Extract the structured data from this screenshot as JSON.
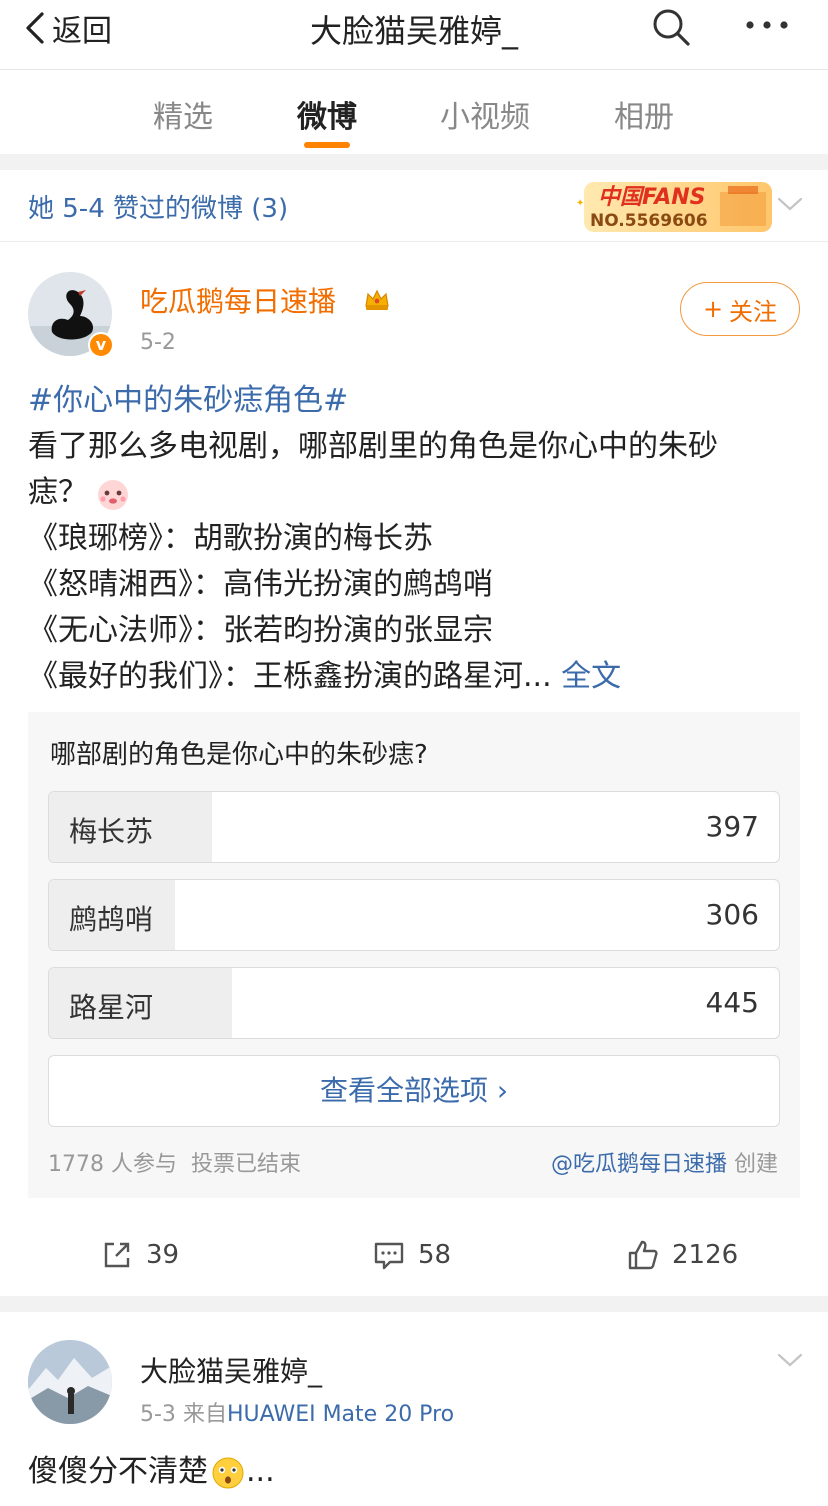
{
  "nav": {
    "back_label": "返回",
    "title": "大脸猫吴雅婷_"
  },
  "tabs": [
    "精选",
    "微博",
    "小视频",
    "相册"
  ],
  "liked": {
    "text": "她 5-4 赞过的微博 (3)",
    "badge_title": "中国FANS",
    "badge_no": "NO.5569606"
  },
  "post1": {
    "author": "吃瓜鹅每日速播",
    "date": "5-2",
    "follow_label": "关注",
    "topic": "#你心中的朱砂痣角色#",
    "line1": "看了那么多电视剧，哪部剧里的角色是你心中的朱砂",
    "line2": "痣？",
    "line3": "《琅琊榜》：胡歌扮演的梅长苏",
    "line4": "《怒晴湘西》：高伟光扮演的鹧鸪哨",
    "line5": "《无心法师》：张若昀扮演的张显宗",
    "line6": "《最好的我们》：王栎鑫扮演的路星河...",
    "full_text": "全文"
  },
  "poll": {
    "question": "哪部剧的角色是你心中的朱砂痣?",
    "options": [
      {
        "label": "梅长苏",
        "count": "397",
        "share": 0.223
      },
      {
        "label": "鹧鸪哨",
        "count": "306",
        "share": 0.172
      },
      {
        "label": "路星河",
        "count": "445",
        "share": 0.25
      }
    ],
    "view_all": "查看全部选项 ›",
    "participants": "1778 人参与",
    "status": "投票已结束",
    "creator": "@吃瓜鹅每日速播",
    "created": "创建"
  },
  "actions": {
    "repost": "39",
    "comment": "58",
    "like": "2126"
  },
  "post2": {
    "author": "大脸猫吴雅婷_",
    "date": "5-3",
    "source_prefix": "来自",
    "source": "HUAWEI Mate 20 Pro",
    "text": "傻傻分不清楚",
    "ellipsis": "..."
  }
}
